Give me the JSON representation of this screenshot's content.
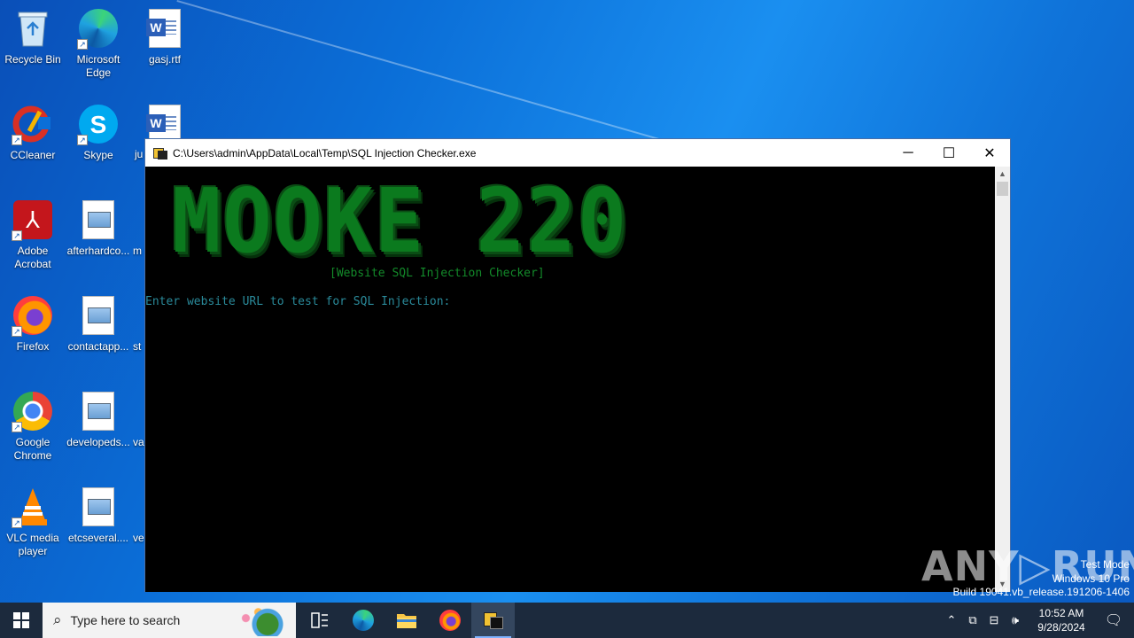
{
  "desktop": {
    "icons": [
      {
        "label": "Recycle Bin",
        "icon": "recycle-bin-icon"
      },
      {
        "label": "Microsoft Edge",
        "icon": "edge-icon"
      },
      {
        "label": "gasj.rtf",
        "icon": "word-document-icon"
      },
      {
        "label": "CCleaner",
        "icon": "ccleaner-icon"
      },
      {
        "label": "Skype",
        "icon": "skype-icon"
      },
      {
        "label": "ju",
        "icon": "word-document-icon"
      },
      {
        "label": "Adobe Acrobat",
        "icon": "acrobat-icon"
      },
      {
        "label": "afterhardco...",
        "icon": "image-file-icon"
      },
      {
        "label": "m",
        "icon": "file-icon"
      },
      {
        "label": "Firefox",
        "icon": "firefox-icon"
      },
      {
        "label": "contactapp...",
        "icon": "image-file-icon"
      },
      {
        "label": "st",
        "icon": "file-icon"
      },
      {
        "label": "Google Chrome",
        "icon": "chrome-icon"
      },
      {
        "label": "developeds...",
        "icon": "image-file-icon"
      },
      {
        "label": "va",
        "icon": "file-icon"
      },
      {
        "label": "VLC media player",
        "icon": "vlc-icon"
      },
      {
        "label": "etcseveral....",
        "icon": "image-file-icon"
      },
      {
        "label": "ve",
        "icon": "file-icon"
      }
    ]
  },
  "window": {
    "title": "C:\\Users\\admin\\AppData\\Local\\Temp\\SQL Injection Checker.exe",
    "minimize": "─",
    "maximize": "☐",
    "close": "✕",
    "banner": "MOOKE 220",
    "subtitle": "[Website SQL Injection Checker]",
    "prompt": "Enter website URL to test for SQL Injection:"
  },
  "watermark": {
    "text": "ANY▷RUN"
  },
  "system_info": {
    "line1": "Test Mode",
    "line2": "Windows 10 Pro",
    "line3": "Build 19041.vb_release.191206-1406"
  },
  "taskbar": {
    "search_placeholder": "Type here to search",
    "time": "10:52 AM",
    "date": "9/28/2024"
  },
  "colors": {
    "banner_green": "#0b7a1e",
    "subtitle_green": "#138a2a",
    "prompt_teal": "#2a8a9a",
    "taskbar_bg": "#1c2a3d"
  }
}
